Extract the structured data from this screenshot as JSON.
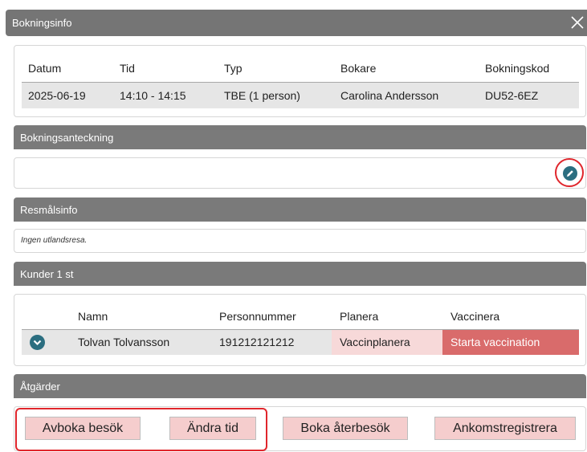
{
  "dialog": {
    "title": "Bokningsinfo",
    "close_icon": "close-icon"
  },
  "booking": {
    "headers": [
      "Datum",
      "Tid",
      "Typ",
      "Bokare",
      "Bokningskod"
    ],
    "row": [
      "2025-06-19",
      "14:10 - 14:15",
      "TBE (1 person)",
      "Carolina Andersson",
      "DU52-6EZ"
    ]
  },
  "note_section": {
    "title": "Bokningsanteckning",
    "edit_icon": "pencil-icon"
  },
  "destination_section": {
    "title": "Resmålsinfo",
    "text": "Ingen utlandsresa."
  },
  "customers_section": {
    "title": "Kunder 1 st",
    "headers": [
      "",
      "Namn",
      "Personnummer",
      "Planera",
      "Vaccinera"
    ],
    "row": {
      "name": "Tolvan Tolvansson",
      "personnummer": "191212121212",
      "plan": "Vaccinplanera",
      "vaccinate": "Starta vaccination"
    }
  },
  "actions_section": {
    "title": "Åtgärder",
    "buttons": {
      "cancel": "Avboka besök",
      "change_time": "Ändra tid",
      "book_return": "Boka återbesök",
      "check_in": "Ankomstregistrera"
    }
  },
  "colors": {
    "header_bar": "#757575",
    "accent": "#2b6e80",
    "highlight": "#e0262c",
    "vaccinate_bg": "#d96b6b",
    "plan_bg": "#f7d9d9"
  }
}
